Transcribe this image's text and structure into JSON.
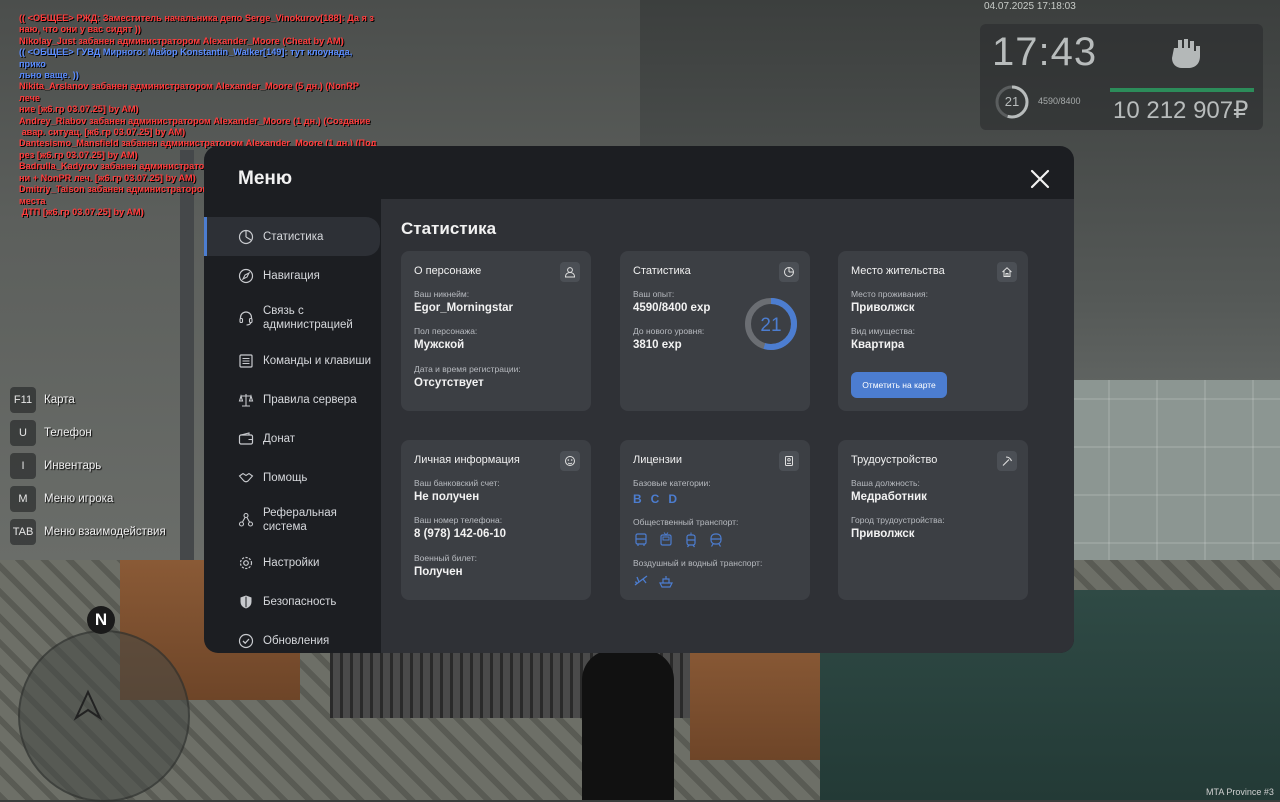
{
  "chat": [
    {
      "color": "red",
      "text": "(( <ОБЩЕЕ> РЖД: Заместитель начальника депо Serge_Vinokurov[188]: Да я з\nнаю, что они у вас сидят ))"
    },
    {
      "color": "red",
      "text": "Nikolay_Just забанен администратором Alexander_Moore (Cheat by AM)"
    },
    {
      "color": "blue",
      "text": "(( <ОБЩЕЕ> ГУВД Мирного: Майор Konstantin_Walker[149]: тут клоунада, прико\nльно ваще. ))"
    },
    {
      "color": "red",
      "text": "Nikita_Arslanov забанен администратором Alexander_Moore (5 дн.) (NonRP лече\nние [ж6.гр 03.07.25] by AM)"
    },
    {
      "color": "red",
      "text": "Andrey_Riabov забанен администратором Alexander_Moore (1 дн.) (Создание\n авар. ситуац. [ж6.гр 03.07.25] by AM)"
    },
    {
      "color": "red",
      "text": "Dantesismo_Mansfield забанен администратором Alexander_Moore (1 дн.) (Под\nрез [ж6.гр 03.07.25] by AM)"
    },
    {
      "color": "red",
      "text": "Badrulla_Kadyrov забанен администратором Alexander_Moore (35 дн.) (Оск.род\nни + NonPR леч. [ж6.гр 03.07.25] by AM)"
    },
    {
      "color": "red",
      "text": "Dmitriy_Taison забанен администратором Alexander_Moore (5 дн.) (Уход с места\n ДТП [ж6.гр 03.07.25] by AM)"
    }
  ],
  "hud": {
    "datetime": "04.07.2025 17:18:03",
    "time": "17:43",
    "level": "21",
    "exp": "4590/8400",
    "money": "10 212 907₽",
    "fist_icon": "fist-icon"
  },
  "hotkeys": [
    {
      "key": "F11",
      "label": "Карта"
    },
    {
      "key": "U",
      "label": "Телефон"
    },
    {
      "key": "I",
      "label": "Инвентарь"
    },
    {
      "key": "M",
      "label": "Меню игрока"
    },
    {
      "key": "TAB",
      "label": "Меню взаимодействия"
    }
  ],
  "minimap": {
    "compass": "N"
  },
  "watermark": "MTA Province #3",
  "menu": {
    "title": "Меню",
    "nav": [
      {
        "label": "Статистика",
        "icon": "pie-chart-icon",
        "active": true
      },
      {
        "label": "Навигация",
        "icon": "compass-icon"
      },
      {
        "label": "Связь с\nадминистрацией",
        "icon": "headset-icon"
      },
      {
        "label": "Команды и клавиши",
        "icon": "list-icon"
      },
      {
        "label": "Правила сервера",
        "icon": "scales-icon"
      },
      {
        "label": "Донат",
        "icon": "wallet-icon"
      },
      {
        "label": "Помощь",
        "icon": "handshake-icon"
      },
      {
        "label": "Реферальная\nсистема",
        "icon": "referral-icon"
      },
      {
        "label": "Настройки",
        "icon": "gear-icon"
      },
      {
        "label": "Безопасность",
        "icon": "shield-icon"
      },
      {
        "label": "Обновления",
        "icon": "check-badge-icon"
      }
    ],
    "content": {
      "title": "Статистика",
      "character": {
        "title": "О персонаже",
        "nickname_label": "Ваш никнейм:",
        "nickname": "Egor_Morningstar",
        "gender_label": "Пол персонажа:",
        "gender": "Мужской",
        "reg_label": "Дата и время регистрации:",
        "reg": "Отсутствует"
      },
      "stats": {
        "title": "Статистика",
        "exp_label": "Ваш опыт:",
        "exp": "4590/8400 exp",
        "next_label": "До нового уровня:",
        "next": "3810 exp",
        "level": "21",
        "progress": 0.546
      },
      "residence": {
        "title": "Место жительства",
        "place_label": "Место проживания:",
        "place": "Приволжск",
        "property_label": "Вид имущества:",
        "property": "Квартира",
        "button": "Отметить на карте"
      },
      "personal": {
        "title": "Личная информация",
        "bank_label": "Ваш банковский счет:",
        "bank": "Не получен",
        "phone_label": "Ваш номер телефона:",
        "phone": "8 (978) 142-06-10",
        "military_label": "Военный билет:",
        "military": "Получен"
      },
      "licenses": {
        "title": "Лицензии",
        "basic_label": "Базовые категории:",
        "basic": [
          "B",
          "C",
          "D"
        ],
        "public_label": "Общественный транспорт:",
        "public_icons": [
          "bus-icon",
          "trolleybus-icon",
          "tram-icon",
          "metro-icon"
        ],
        "air_label": "Воздушный и водный транспорт:",
        "air_icons": [
          "plane-icon",
          "boat-icon"
        ]
      },
      "employment": {
        "title": "Трудоустройство",
        "position_label": "Ваша должность:",
        "position": "Медработник",
        "city_label": "Город трудоустройства:",
        "city": "Приволжск"
      }
    }
  },
  "colors": {
    "accent": "#4c7dd0",
    "panel": "#1c1e22",
    "content": "#2f3136",
    "card": "#3c3f44",
    "money_bar": "#2c8c5a"
  }
}
